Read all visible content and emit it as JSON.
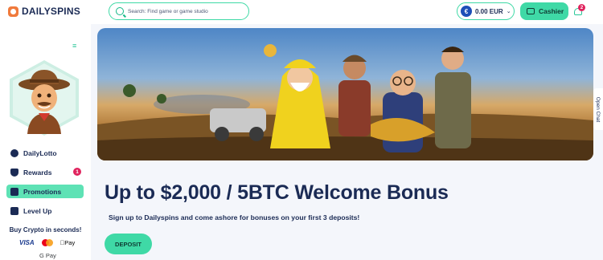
{
  "brand": {
    "name": "DAILYSPINS"
  },
  "header": {
    "search_placeholder": "Search: Find game or game studio",
    "balance": "0.00 EUR",
    "currency_symbol": "€",
    "cashier_label": "Cashier",
    "notifications_count": "2"
  },
  "sidebar": {
    "items": [
      {
        "label": "DailyLotto",
        "icon": "lotto-icon"
      },
      {
        "label": "Rewards",
        "icon": "trophy-icon",
        "badge": "1"
      },
      {
        "label": "Promotions",
        "icon": "megaphone-icon",
        "active": true
      },
      {
        "label": "Level Up",
        "icon": "level-chart-icon"
      }
    ],
    "buy_crypto": "Buy Crypto in seconds!",
    "payments": {
      "visa": "VISA",
      "apple_pay": "Pay",
      "google_pay": "G Pay"
    }
  },
  "promo": {
    "headline": "Up to $2,000 / 5BTC Welcome Bonus",
    "subline": "Sign up to Dailyspins and come ashore for bonuses on your first 3 deposits!",
    "deposit_label": "DEPOSIT"
  },
  "chat": {
    "label": "Open Chat"
  },
  "colors": {
    "accent": "#3fd9a6",
    "navy": "#1b2b55",
    "badge": "#e0245e"
  }
}
